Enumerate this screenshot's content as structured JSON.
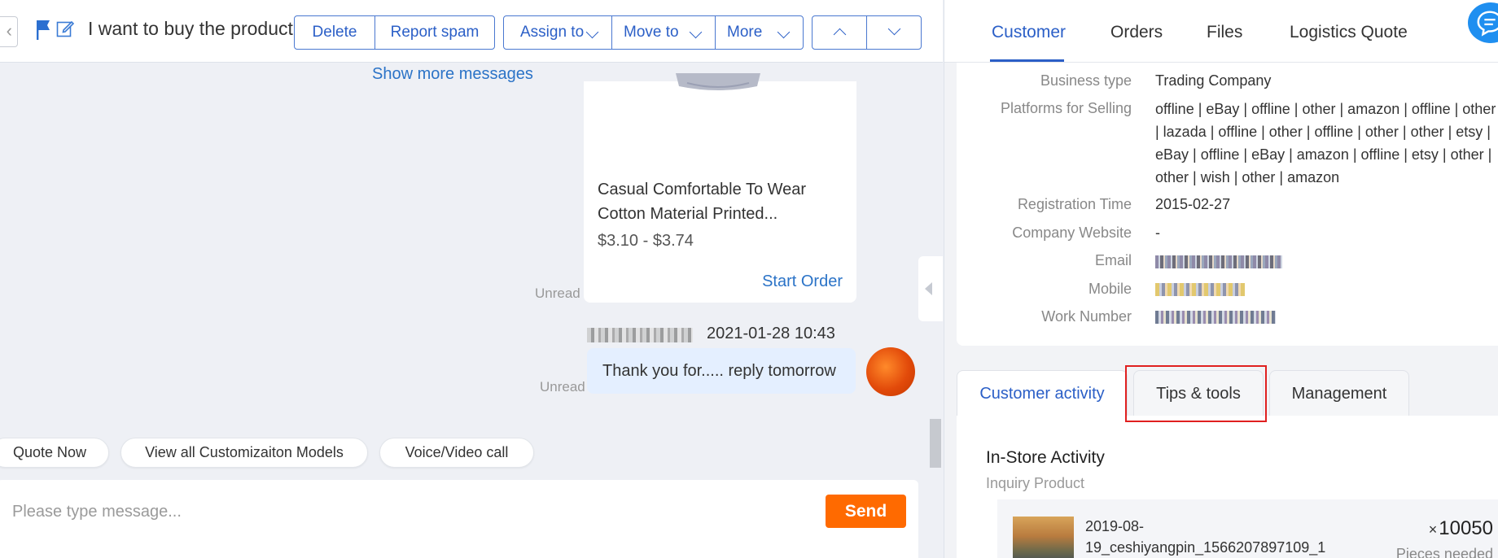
{
  "header": {
    "subject": "I want to buy the product",
    "buttons": {
      "delete": "Delete",
      "report_spam": "Report spam",
      "assign_to": "Assign to",
      "move_to": "Move to",
      "more": "More"
    }
  },
  "chat": {
    "show_more": "Show more messages",
    "product": {
      "name": "Casual Comfortable To Wear Cotton Material Printed...",
      "price": "$3.10 - $3.74",
      "action": "Start Order",
      "status": "Unread"
    },
    "message": {
      "time": "2021-01-28 10:43",
      "text": "Thank you for..... reply tomorrow",
      "status": "Unread"
    },
    "quick_actions": [
      "Quote Now",
      "View all Customizaiton Models",
      "Voice/Video call"
    ],
    "input_placeholder": "Please type message...",
    "send_label": "Send"
  },
  "right_tabs": [
    "Customer",
    "Orders",
    "Files",
    "Logistics Quote"
  ],
  "customer_info": {
    "business_type_label": "Business type",
    "business_type": "Trading Company",
    "platforms_label": "Platforms for Selling",
    "platforms": "offline | eBay | offline | other | amazon | offline | other | lazada | offline | other | offline | other | other | etsy | eBay | offline | eBay | amazon | offline | etsy | other | other | wish | other | amazon",
    "registration_label": "Registration Time",
    "registration": "2015-02-27",
    "website_label": "Company Website",
    "website": "-",
    "email_label": "Email",
    "mobile_label": "Mobile",
    "work_number_label": "Work Number"
  },
  "activity_tabs": [
    "Customer activity",
    "Tips & tools",
    "Management"
  ],
  "activity": {
    "title": "In-Store Activity",
    "subtitle": "Inquiry Product",
    "item": {
      "name": "2019-08-19_ceshiyangpin_1566207897109_1",
      "qty_prefix": "×",
      "qty": "10050",
      "unit": "Pieces needed"
    }
  },
  "icons": {
    "flag": "flag-icon",
    "edit": "edit-icon",
    "chat": "chat-bubble-icon"
  },
  "colors": {
    "accent": "#2b5fc7",
    "send": "#ff6a00",
    "highlight": "#e02020"
  }
}
